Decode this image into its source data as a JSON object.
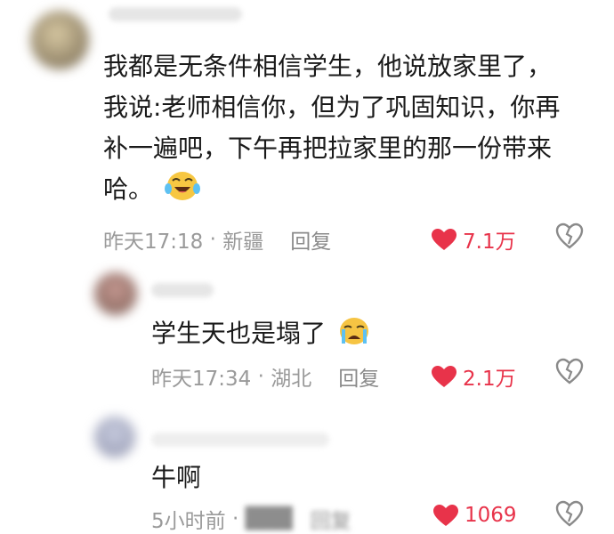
{
  "colors": {
    "like": "#e8334a",
    "meta": "#9a9a9a",
    "text": "#1a1a1a"
  },
  "comments": [
    {
      "body_lines": [
        "我都是无条件相信学生，他说放家里了，",
        "我说:老师相信你，但为了巩固知识，你再",
        "补一遍吧，下午再把拉家里的那一份带来",
        "哈。"
      ],
      "emoji": "laughing-tears-emoji",
      "time": "昨天17:18",
      "location": "新疆",
      "reply_label": "回复",
      "likes": "7.1万"
    },
    {
      "body": "学生天也是塌了",
      "emoji": "crying-emoji",
      "time": "昨天17:34",
      "location": "湖北",
      "reply_label": "回复",
      "likes": "2.1万"
    },
    {
      "body": "牛啊",
      "time": "5小时前",
      "reply_label": "回复",
      "likes": "1069"
    }
  ]
}
